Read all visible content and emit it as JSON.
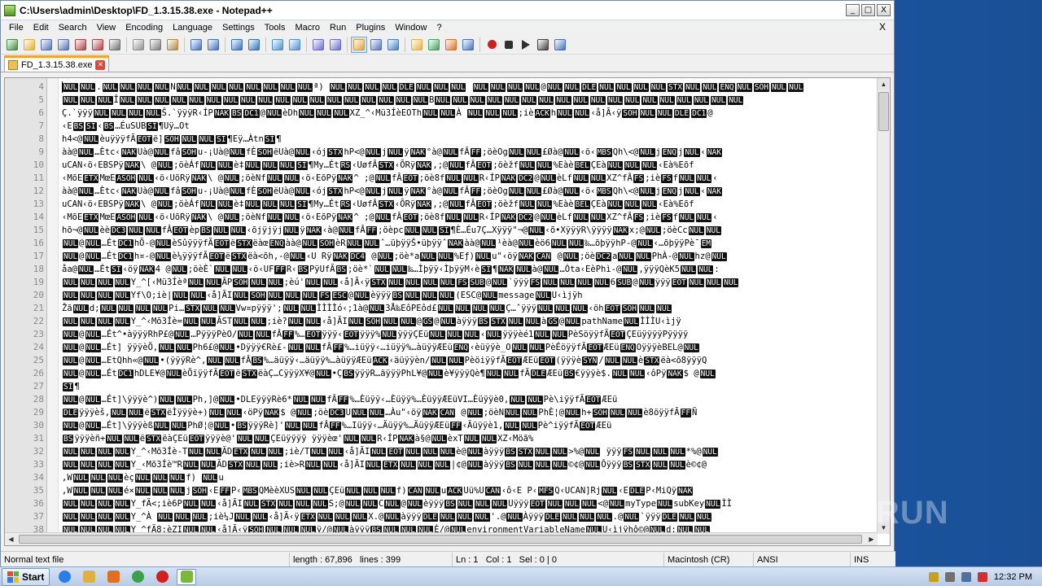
{
  "window": {
    "title": "C:\\Users\\admin\\Desktop\\FD_1.3.15.38.exe - Notepad++",
    "min_glyph": "_",
    "max_glyph": "□",
    "close_glyph": "X",
    "doc_close_glyph": "X"
  },
  "menu": [
    "File",
    "Edit",
    "Search",
    "View",
    "Encoding",
    "Language",
    "Settings",
    "Tools",
    "Macro",
    "Run",
    "Plugins",
    "Window",
    "?"
  ],
  "toolbar": {
    "icons": [
      "new-icon",
      "open-icon",
      "save-icon",
      "save-all-icon",
      "close-icon",
      "close-all-icon",
      "print-icon",
      "sep",
      "cut-icon",
      "copy-icon",
      "paste-icon",
      "sep",
      "undo-icon",
      "redo-icon",
      "sep",
      "find-icon",
      "replace-icon",
      "sep",
      "zoom-in-icon",
      "zoom-out-icon",
      "sep",
      "sync-v-icon",
      "sync-h-icon",
      "sep",
      "word-wrap-icon",
      "all-chars-icon",
      "indent-guide-icon",
      "sep",
      "doc-map-icon",
      "function-list-icon",
      "folder-workspace-icon",
      "monitoring-icon",
      "sep",
      "record-macro-icon",
      "stop-macro-icon",
      "play-macro-icon",
      "run-macro-multiple-icon",
      "save-macro-icon"
    ],
    "colors": {
      "new": "#3a8f3a",
      "open": "#e0b030",
      "save": "#5470b8",
      "print": "#707070",
      "cut": "#909090",
      "edit": "#4070c0",
      "macro_red": "#d02020"
    }
  },
  "tab": {
    "label": "FD_1.3.15.38.exe"
  },
  "editor": {
    "lines": [
      {
        "n": "4",
        "text": "[NUL][NUL].[NUL][NUL][NUL][NUL]N[NUL][NUL][NUL][NUL][NUL][NUL][NUL][NUL]ª) [NUL][NUL][NUL][NUL][DLE][NUL][NUL][NUL] [NUL][NUL][NUL][NUL]@[NUL][NUL][DLE][NUL][NUL][NUL][NUL][STX][NUL][NUL][ENQ][NUL][SOH][NUL][NUL]"
      },
      {
        "n": "5",
        "text": "[NUL][NUL][NUL]Î[NUL][NUL][NUL][NUL][NUL][NUL][NUL][NUL][NUL][NUL][NUL][NUL][NUL][NUL][NUL][NUL][NUL][NUL]B[NUL][NUL][NUL][NUL][NUL][NUL][NUL][NUL][NUL][NUL][NUL][NUL][NUL][NUL][NUL][NUL][NUL][NUL]"
      },
      {
        "n": "6",
        "text": "Ç.`ÿÿÿ[NUL][NUL][NUL][NUL]Š.`ÿÿÿR‹ÍP[NAK][BS][DC1]@[NUL]èDh[NUL][NUL][NUL]XZ_^‹Mü3ÍèEOTh[NUL][NUL]À [NUL][NUL][NUL];iè[ACK]h[NUL][NUL]‹å]Ã‹ÿ[SOH][NUL][NUL][DLE][DC1]@"
      },
      {
        "n": "7",
        "text": "‹E[BS][SI]‹[BS]…ÉuSUB[SI]¶Uÿ…Ot"
      },
      {
        "n": "8",
        "text": "h4<@[NUL]èuÿÿÿfÃ[EOT]ë][SOH][NUL][NUL][SI]¶Eÿ…Àtn[SI]¶"
      },
      {
        "n": "9",
        "text": "àà@[NUL]…Ètc‹[NAK]Uà@[NUL]fâ[SOH]u-¡Uà@[NUL]fÈ[SOH]ëUà@[NUL]‹ój[STX]hP<@[NUL]j[NUL]ÿ[NAK]°à@[NUL]fÂ[FF];öèOg[NUL][NUL]£Øà@[NUL]‹ö‹[MBS]Qh\\<@[NUL]j[ENQ]j[NUL]‹[NAK]"
      },
      {
        "n": "10",
        "text": "uCAN‹ö‹EBSPÿ[NAK]\\ @[NUL];öèÁf[NUL][NUL]è‡[NUL][NUL][NUL][SI]¶My…Ét[RS]‹UøfÂ[STX]‹ÕRÿ[NAK]‚;@[NUL]fÂ[EOT];öèžf[NUL][NUL]%Eàè[BEL]ÇEà[NUL][NUL][NUL]‹Eà%Eõf"
      },
      {
        "n": "11",
        "text": "‹MõE[ETX]MœE[ASOH][NUL]‹ö‹UõRÿ[NAK]\\ @[NUL];öèNf[NUL][NUL]‹ö‹EõPÿ[NAK]^ ;@[NUL]fÂ[EOT];öè8f[NUL][NUL]R‹ÍP[NAK][DC2]@[NUL]èLf[NUL][NUL]XZ^fÂ[FS];iè[FS]f[NUL][NUL]‹"
      },
      {
        "n": "12",
        "text": "àà@[NUL]…Ètc‹[NAK]Uà@[NUL]fâ[SOH]u-¡Uà@[NUL]fÈ[SOH]ëUà@[NUL]‹ój[STX]hP<@[NUL]j[NUL]ÿ[NAK]°à@[NUL]fÂ[FF];öèOg[NUL][NUL]£Øà@[NUL]‹ö‹[MBS]Qh\\<@[NUL]j[ENQ]j[NUL]‹[NAK]"
      },
      {
        "n": "13",
        "text": "uCAN‹ö‹EBSPÿ[NAK]\\ @[NUL];öèÁf[NUL][NUL]è‡[NUL][NUL][NUL][SI]¶My…Ét[RS]‹UøfÂ[STX]‹ÕRÿ[NAK]‚;@[NUL]fÂ[EOT];öèžf[NUL][NUL]%Eàè[BEL]ÇEà[NUL][NUL][NUL]‹Eà%Eõf"
      },
      {
        "n": "14",
        "text": "‹MõE[ETX]MœE[ASOH][NUL]‹ö‹UõRÿ[NAK]\\ @[NUL];öèNf[NUL][NUL]‹ö‹EõPÿ[NAK]^ ;@[NUL]fÂ[EOT];öè8f[NUL][NUL]R‹ÍP[NAK][DC2]@[NUL]èLf[NUL][NUL]XZ^fÂ[FS];iè[FS]f[NUL][NUL]‹"
      },
      {
        "n": "15",
        "text": "hõ¬@[NUL]èè[DC3][NUL][NUL]fÂ[EOT]èp[BS][NUL][NUL]‹õjÿjÿj[NUL]ÿ[NAK]‹à@[NUL]fÂ[FF];öèpc[NUL][NUL][SI]¶È…Éu7Ç…Xÿÿÿ\"¬@[NUL]‹õ•XÿÿÿR\\ÿÿÿÿ[NAK]x;@[NUL];öèCc[NUL][NUL]"
      },
      {
        "n": "16",
        "text": "[NUL]@[NUL]…Ét[DC1]hÕ-@[NUL]èSûÿÿÿfÃ[EOT]ë[STX]ëàœ[ENQ]àà@[NUL][SOH]èR[NUL][NUL]ˆ…üþÿÿŠ•üþÿÿˆ[NAK]àà@[NUL]¹èà@[NUL]èö6[NUL][NUL]‰…õþÿÿhP-@[NUL]‹…õþÿÿPè¯[EM]"
      },
      {
        "n": "17",
        "text": "[NUL]@[NUL]…Ét[DC1]h¤-@[NUL]è¼ÿÿÿfÃ[EOT]ë[STX]ëà<õh,-@[NUL]‹U Rÿ[NAK][DC4] @[NUL];öè*a[NUL][NUL]%Eƒ)[NUL]u\"‹öÿ[NAK][CAN] @[NUL];öè[DC2]a[NUL][NUL]PhÀ-@[NUL]hz@[NUL]"
      },
      {
        "n": "18",
        "text": "åa@[NUL]…Ét[SI]‹öÿ[NAK]4 @[NUL];öèÈ`[NUL][NUL]‹ö‹UF[FF]R‹[BS]PÿUfÃ[BS];öè*`[NUL][NUL]‰…Ìþÿÿ‹ÌþÿÿM‹è[SI]¶[NAK][NUL]à@[NUL]…Òta‹EèPhì-@[NUL],ÿÿÿQèK5[NUL][NUL]:"
      },
      {
        "n": "19",
        "text": "[NUL][NUL][NUL][NUL]Y_^[‹Mü3Íèª[NUL][NUL]ÃP[SOH][NUL][NUL];èú'[NUL][NUL]‹å]Ã‹ÿ[STX][NUL][NUL][NUL][NUL][FS][SUB]@[NUL]`ÿÿÿ[FS][NUL][NUL][NUL][NUL]6[SUB]@[NUL]ÿÿÿ[EOT][NUL][NUL][NUL]"
      },
      {
        "n": "20",
        "text": "[NUL][NUL][NUL][NUL]Yf\\O;iè|[NUL][NUL]‹å]ÃI[NUL][SOH][NUL][NUL][NUL][FS][ESC]@[NUL]èÿÿÿ[BS][NUL][NUL][NUL](ESC@[NUL]message[NUL]U‹ìjÿh"
      },
      {
        "n": "21",
        "text": "Žã[NUL]d;[NUL][NUL][NUL][NUL]Pi…[STX][NUL][NUL]Vw¤pÿÿÿ';[NUL][NUL]ÌÌÌÌó‹;1à@[NUL]3Å‰EôPEôd£[NUL][NUL][NUL][NUL]Ç…ˆÿÿÿ[NUL][NUL][NUL]‹öh[EOT][SOH][NUL][NUL]"
      },
      {
        "n": "22",
        "text": "[NUL][NUL][NUL][NUL]Y_^‹Mõ3Íè=[NUL][NUL]ÃST[NUL][NUL];iè?[NUL][NUL]‹å]ÃI[NUL][SOH][NUL][NUL]@[GS]@[NUL]àÿÿÿ[BS][STX][NUL][NUL]à[GS]@[NUL]pathName[NUL]ÌÌÌU‹ìjÿ"
      },
      {
        "n": "23",
        "text": "[NUL]@[NUL]…Ét^•àÿÿÿRhP£@[NUL]…PÿÿÿPèO/[NUL][NUL]fÂ[FF]%…[EOT]ÿÿÿ‹[EOT]ÿÿÿ%[NUL]ÿÿÿÇEü[NUL][NUL][NUL]‹[NUL]ÿÿÿèé1[NUL][NUL]PèSöÿÿfÃ[EOT]ÇEüÿÿÿÿPÿÿÿÿ"
      },
      {
        "n": "24",
        "text": "[NUL]@[NUL]…Ét] ÿÿÿèÕ,[NUL][NUL]Ph6£@[NUL]•Dÿÿÿ€Rè£-[NUL][NUL]fÂ[FF]%…iüÿÿ‹…iüÿÿ%…àüÿÿÆEü[ENQ]‹èüÿÿè_O[NUL][NUL]PèÉöÿÿfÃ[EOT]ÆEü[ENQ]OÿÿÿèBEL@[NUL]"
      },
      {
        "n": "25",
        "text": "[NUL]@[NUL]…EtQhh«@[NUL]•(ÿÿÿRè^,[NUL][NUL]fÂ[BS]%…äüÿÿ‹…äüÿÿ%…àüÿÿÆEü[ACK]‹äüÿÿèn/[NUL][NUL]PèöiÿÿfÃ[EOT]ÆEü[EOT](ÿÿÿè[SYN]/[NUL][NUL]è[STX]ëà<õ8ÿÿÿQ"
      },
      {
        "n": "26",
        "text": "[NUL]@[NUL]…Ét[DC1]hDLE¥@[NUL]èÕïÿÿfÃ[EOT]ë[STX]ëàÇ…CÿÿÿX¥@[NUL]•Ç[BS]ÿÿÿR…äÿÿÿPhL¥@[NUL]è¥ÿÿÿQè¶[NUL][NUL]fÃ[DLE]ÆEü[BS]€ÿÿÿè$.[NUL][NUL]‹ôPÿ[NAK]$ @[NUL]"
      },
      {
        "n": "27",
        "text": "[SI]¶"
      },
      {
        "n": "28",
        "text": "[NUL]@[NUL]…Ét]\\ÿÿÿè^)[NUL][NUL]Ph,]@[NUL]•DLEÿÿÿRè6*[NUL][NUL]fÂ[FF]%…Èüÿÿ‹…Èüÿÿ%…ÈüÿÿÆEüVI…Èüÿÿè0,[NUL][NUL]Pè\\iÿÿfÃ[EOT]ÆEü"
      },
      {
        "n": "29",
        "text": "[DLE]ÿÿÿèš,[NUL][NUL]ë[STX]ëÌÿÿÿè+)[NUL][NUL]‹öPÿ[NAK]$ @[NUL];öè[DC3]U[NUL][NUL]…Àu\"‹öÿ[NAK][CAN] @[NUL];öèN[NUL][NUL]PhÈ¦@[NUL]h+[SOH][NUL][NUL]è8öÿÿfÃ[FF]Ñ"
      },
      {
        "n": "30",
        "text": "[NUL]@[NUL]…Ét]\\ÿÿÿèß[NUL][NUL]PhØ¦@[NUL]•[BS]ÿÿÿRè]'[NUL][NUL]fÂ[FF]%…Iüÿÿ‹…Äüÿÿ%…ÄüÿÿÆEü[FF]‹Äüÿÿè1,[NUL][NUL]Pè^iÿÿfÃ[EOT]ÆEü"
      },
      {
        "n": "31",
        "text": "[BS]ÿÿÿèñ+[NUL][NUL]ë[STX]ëàÇEü[EOT]ÿÿÿè@'[NUL][NUL]ÇEüÿÿÿÿ ÿÿÿèœ'[NUL][NUL]R‹ÍP[NAK]à§@[NUL]èxT[NUL][NUL]XZ‹Möã%"
      },
      {
        "n": "32",
        "text": "[NUL][NUL][NUL][NUL]Y_^‹Mõ3Íè-T[NUL][NUL]ÃD[ETX][NUL][NUL];iè/T[NUL][NUL]‹å]ÃI[NUL][EOT][NUL][NUL][NUL]è@[NUL]àÿÿÿ[BS][STX][NUL][NUL]>%@[NUL] ÿÿÿ[FS][NUL][NUL][NUL]*%@[NUL]"
      },
      {
        "n": "33",
        "text": "[NUL][NUL][NUL][NUL]Y_‹Mõ3Íè™R[NUL][NUL]ÃD[STX][NUL][NUL];iè>R[NUL][NUL]‹å]ÃI[NUL][ETX][NUL][NUL][NUL]|¢@[NUL]àÿÿÿ[BS][NUL][NUL][NUL]©¢@[NUL]Ôÿÿÿ[BS][STX][NUL][NUL]è©¢@"
      },
      {
        "n": "34",
        "text": ",W[NUL][NUL][NUL]èç[NUL][NUL][NUL]f) [NUL]u"
      },
      {
        "n": "35",
        "text": ",W[NUL][NUL][NUL]é×[NUL][NUL][NUL]j[SOH]‹E[FF]P‹[MBS]QMèèXUS[NUL][NUL]ÇEü[NUL][NUL][NUL]f)[CAN][NUL]u[ACK]Uü%U[CAN]‹ô‹E P‹[MFS]Q‹UCAN]Rj[NUL]‹E[DLE]P‹MiQÿ[NAK]"
      },
      {
        "n": "36",
        "text": "[NUL][NUL][NUL][NUL]Y_fÄ<;iè6P[NUL][NUL]‹å]ÃI[NUL][STX][NUL][NUL][NUL]S;@[NUL][NUL]C[NUL]@[NUL]èÿÿÿ[BS][NUL][NUL][NUL]Uÿÿÿ[EOT][NUL][NUL][NUL]<@[NUL]myType[NUL]subKey[NUL]ÌÌ"
      },
      {
        "n": "37",
        "text": "[NUL][NUL][NUL][NUL]Y_^À [NUL][NUL][NUL];iè¼J[NUL][NUL]‹å]Ã‹ÿ[ETX][NUL][NUL][NUL]X.@[NUL]àÿÿÿ[DLE][NUL][NUL][NUL]'.@[NUL]Àÿÿÿ[DLE][NUL][NUL][NUL].@[NUL]`ÿÿÿ[DLE][NUL][NUL]"
      },
      {
        "n": "38",
        "text": "[NUL][NUL][NUL][NUL]Y_^fÄ8;èZI[NUL][NUL]‹å]Ã‹ÿ[SOH][NUL][NUL][NUL]ÿ/@[NUL]àÿÿÿ[BS][NUL][NUL][NUL]È/@[NUL]environmentVariableName[NUL]U‹ìjÿhô©@[NUL]d;[NUL][NUL]"
      }
    ]
  },
  "status": {
    "file_type": "Normal text file",
    "length": "length : 67,896",
    "lines": "lines : 399",
    "ln": "Ln : 1",
    "col": "Col : 1",
    "sel": "Sel : 0 | 0",
    "eol": "Macintosh (CR)",
    "encoding": "ANSI",
    "mode": "INS"
  },
  "taskbar": {
    "start_label": "Start",
    "clock": "12:32 PM",
    "apps": [
      "ie-icon",
      "explorer-icon",
      "media-player-icon",
      "chrome-icon",
      "stop-icon",
      "notepadpp-icon"
    ]
  },
  "watermark": {
    "text": "RUN"
  }
}
